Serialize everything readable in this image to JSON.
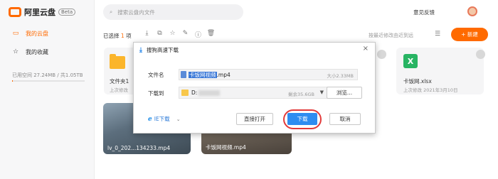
{
  "app": {
    "name": "阿里云盘",
    "badge": "Beta"
  },
  "sidebar": {
    "items": [
      {
        "label": "我的云盘",
        "icon": "folder-icon"
      },
      {
        "label": "我的收藏",
        "icon": "star-icon"
      }
    ],
    "space_text": "已用空间 27.24MB / 共1.05TB",
    "space_used_fraction": 0.0001
  },
  "header": {
    "search_placeholder": "搜索云盘内文件",
    "feedback": "意见反馈"
  },
  "toolbar": {
    "selected_prefix": "已选择",
    "selected_count": "1",
    "selected_suffix": "项",
    "sort_label": "按最近修改由近到远",
    "new_button": "+ 新建"
  },
  "files": [
    {
      "name": "文件夹1",
      "sub": "上次修改"
    },
    {
      "name": "卡饭网.xlsx",
      "sub": "上次修改  2021年3月10日",
      "icon_letter": "X"
    },
    {
      "name": "lv_0_202...134233.mp4"
    },
    {
      "name": "卡饭网视频.mp4"
    }
  ],
  "modal": {
    "title": "搜狗高速下载",
    "close": "×",
    "filename_label": "文件名",
    "filename_highlight": "卡饭网视频",
    "filename_ext": ".mp4",
    "size": "大小2.33MB",
    "dir_label": "下载到",
    "dir_path": "D:",
    "free_space": "剩余35.6GB",
    "browse": "浏览...",
    "ie_label": "IE下载",
    "open_direct": "直接打开",
    "download": "下载",
    "cancel": "取消"
  },
  "colors": {
    "accent": "#ff6a00",
    "primary_blue": "#2e8cf0",
    "highlight_ring": "#e23a3a"
  }
}
